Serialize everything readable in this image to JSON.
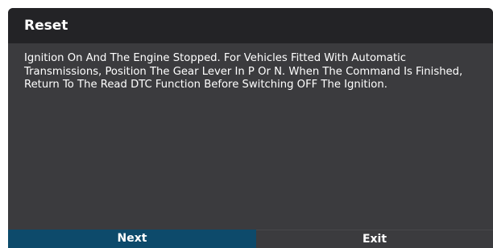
{
  "dialog": {
    "title": "Reset",
    "message": "Ignition On And The Engine Stopped. For Vehicles Fitted With Automatic Transmissions, Position The Gear Lever In P Or N. When The Command Is Finished, Return To The Read DTC Function Before Switching OFF The Ignition."
  },
  "buttons": {
    "next_label": "Next",
    "exit_label": "Exit"
  },
  "colors": {
    "header_bg": "#232326",
    "body_bg": "#3b3b3e",
    "next_bg": "#0d4a6b",
    "text": "#ffffff"
  }
}
